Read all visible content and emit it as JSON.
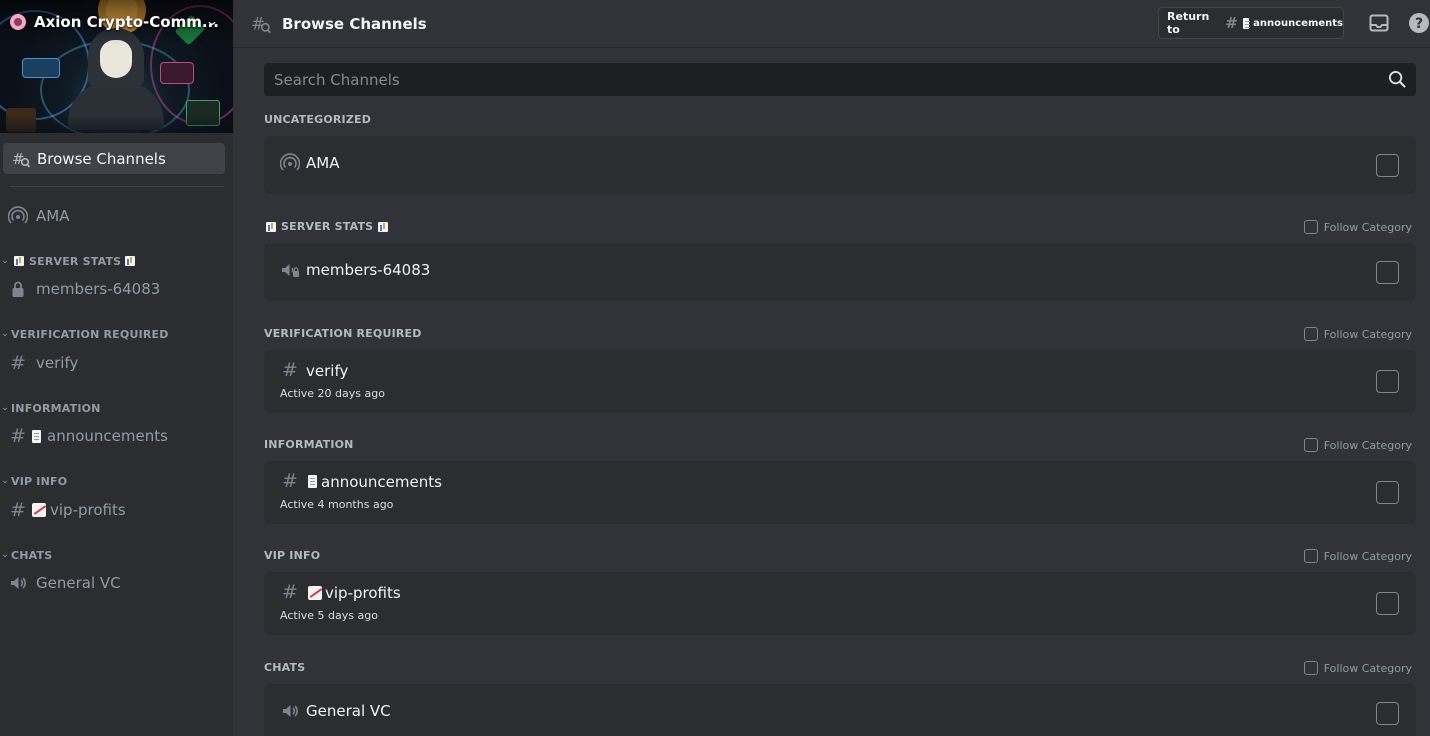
{
  "sidebar": {
    "server_name": "Axion Crypto-Comm...",
    "browse_label": "Browse Channels",
    "channels": [
      {
        "label": "AMA",
        "icon": "stage-icon"
      },
      {
        "label": "members-64083",
        "icon": "lock-icon"
      },
      {
        "label": "verify",
        "icon": "hash-icon"
      },
      {
        "label": "announcements",
        "icon": "hash-icon"
      },
      {
        "label": "vip-profits",
        "icon": "hash-icon"
      },
      {
        "label": "General VC",
        "icon": "speaker-icon"
      }
    ],
    "categories": [
      {
        "label": "SERVER STATS"
      },
      {
        "label": "VERIFICATION REQUIRED"
      },
      {
        "label": "INFORMATION"
      },
      {
        "label": "VIP INFO"
      },
      {
        "label": "CHATS"
      }
    ]
  },
  "header": {
    "title": "Browse Channels",
    "return_label": "Return to",
    "return_channel": "announcements"
  },
  "search": {
    "placeholder": "Search Channels"
  },
  "sections": [
    {
      "category": "UNCATEGORIZED",
      "channel": "AMA",
      "activity": ""
    },
    {
      "category": "SERVER STATS",
      "follow": "Follow Category",
      "channel": "members-64083",
      "activity": ""
    },
    {
      "category": "VERIFICATION REQUIRED",
      "follow": "Follow Category",
      "channel": "verify",
      "activity": "Active 20 days ago"
    },
    {
      "category": "INFORMATION",
      "follow": "Follow Category",
      "channel": "announcements",
      "activity": "Active 4 months ago"
    },
    {
      "category": "VIP INFO",
      "follow": "Follow Category",
      "channel": "vip-profits",
      "activity": "Active 5 days ago"
    },
    {
      "category": "CHATS",
      "follow": "Follow Category",
      "channel": "General VC",
      "activity": ""
    }
  ],
  "colors": {
    "background": "#313338",
    "sidebar": "#2b2d31",
    "selected": "#404249",
    "search_bg": "#1e1f22"
  }
}
